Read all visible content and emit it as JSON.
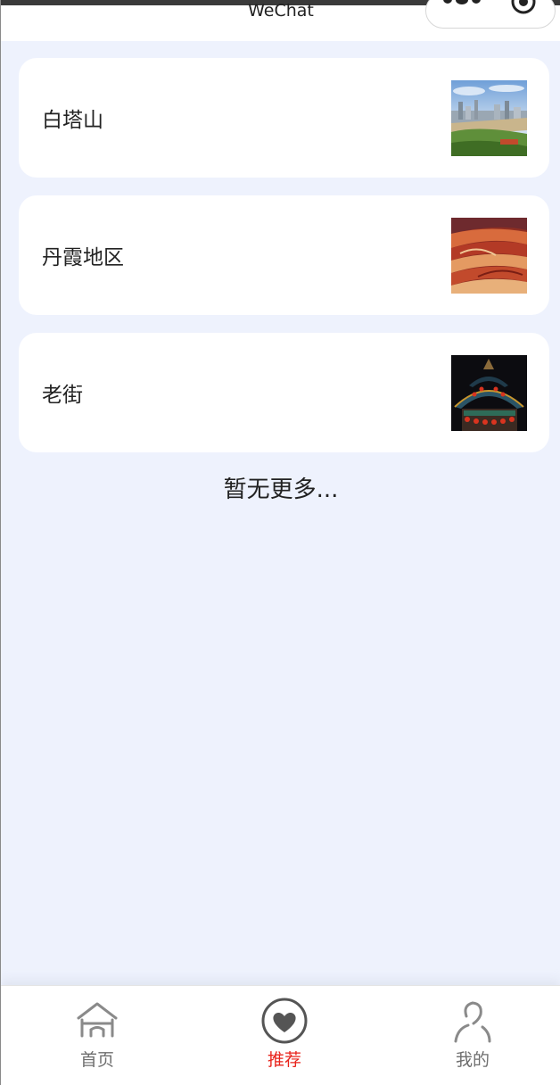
{
  "nav": {
    "title": "WeChat"
  },
  "places": [
    {
      "name": "白塔山",
      "image": "city-landscape-photo"
    },
    {
      "name": "丹霞地区",
      "image": "danxia-red-rock-photo"
    },
    {
      "name": "老街",
      "image": "pagoda-roof-photo"
    }
  ],
  "footer_text": "暂无更多...",
  "tabs": [
    {
      "label": "首页",
      "icon": "home-icon",
      "active": false
    },
    {
      "label": "推荐",
      "icon": "heart-icon",
      "active": true
    },
    {
      "label": "我的",
      "icon": "person-icon",
      "active": false
    }
  ],
  "colors": {
    "background": "#eef2fd",
    "active_tab": "#e8231b",
    "inactive_tab": "#6e6e6e"
  }
}
